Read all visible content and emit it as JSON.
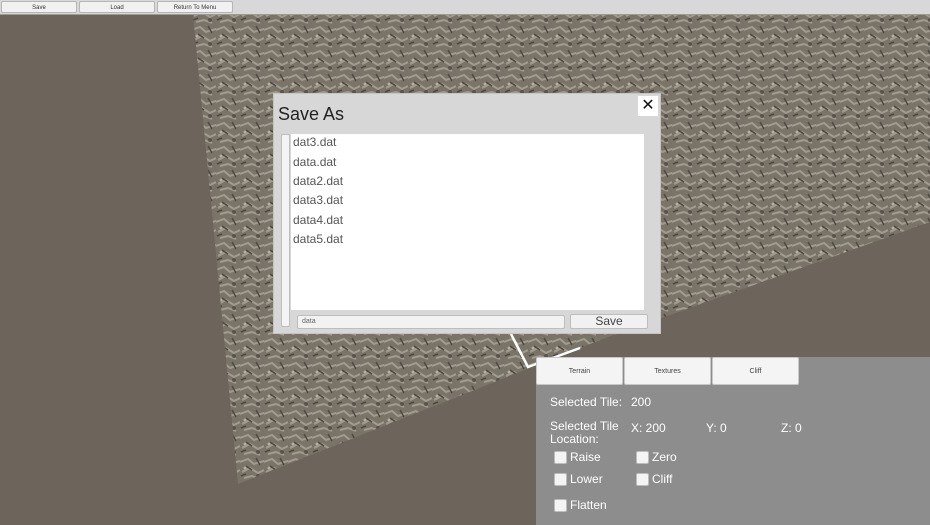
{
  "toolbar": {
    "save_label": "Save",
    "load_label": "Load",
    "return_label": "Return To Menu"
  },
  "dialog": {
    "title": "Save As",
    "close_symbol": "✕",
    "files": [
      "dat3.dat",
      "data.dat",
      "data2.dat",
      "data3.dat",
      "data4.dat",
      "data5.dat"
    ],
    "filename_value": "data",
    "save_label": "Save"
  },
  "panel": {
    "tabs": [
      "Terrain",
      "Textures",
      "Cliff"
    ],
    "selected_tile_label": "Selected Tile:",
    "selected_tile_value": "200",
    "location_label_line1": "Selected Tile",
    "location_label_line2": "Location:",
    "x_text": "X: 200",
    "y_text": "Y: 0",
    "z_text": "Z: 0",
    "options": {
      "raise": "Raise",
      "zero": "Zero",
      "lower": "Lower",
      "cliff": "Cliff",
      "flatten": "Flatten"
    }
  }
}
